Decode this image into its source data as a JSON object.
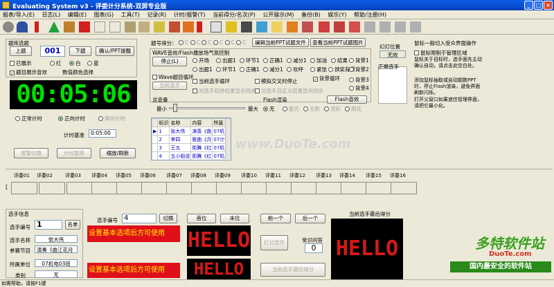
{
  "window": {
    "title": "Evaluating System v3 - 评委计分系统-双屏专业版"
  },
  "menu": [
    "报表/导入(E)",
    "日志(L)",
    "编辑(E)",
    "图表(G)",
    "工具(T)",
    "记录(R)",
    "计时/报警(T)",
    "当前得分/名次(P)",
    "公开展示(M)",
    "备份(B)",
    "娱乐(Y)",
    "帮助/注册(H)"
  ],
  "question": {
    "header": "题库选题",
    "prev": "上题",
    "num": "001",
    "next": "下题",
    "confirm": "确认/PPT提醒",
    "shown": "已展示",
    "colors": [
      "红",
      "白",
      "蓝"
    ],
    "topic_sound": "题目展示音效",
    "num_color": "数值颜色选择"
  },
  "timer": {
    "display": "00:05:06",
    "modes": [
      "正常计时",
      "正向计时",
      "倒向计时"
    ],
    "base_label": "计时基准",
    "base_value": "0:05:00",
    "btn_alarm": "报警切换",
    "btn_pause": "计时暂停",
    "btn_zoom": "缩放/刷新"
  },
  "mid": {
    "diff_label": "题号得分：",
    "diffs": [
      "C",
      "C",
      "C",
      "C",
      "C",
      "C"
    ],
    "load_ppt": "编辑当前PPT试题文件",
    "view_ppt": "查看当前PPT试题图片",
    "wave_group": "WAVE音效/Flash播放场气氛控制",
    "stop": "停止(L)",
    "wave_loop": "Wave题目循环",
    "cur_player": "当前选手",
    "wave_opts": [
      "开场",
      "出题1",
      "环节1",
      "正确1",
      "减分1",
      "加油",
      "结果",
      "背景1",
      "出题1",
      "环节1",
      "正确1",
      "减分1",
      "欢呼",
      "紧张",
      "颁奖背景",
      "背景2",
      "背景3",
      "背景4"
    ],
    "loop": "背景循环",
    "cur_loop": "当前选手循环",
    "auto_stop": "模拟交叉时停止",
    "cur_all": "对选手较终结果显示同步",
    "sync_all": "对选手自定义结果显示同步",
    "total_label": "总音量",
    "min": "最小",
    "max": "最大",
    "flash_label": "Flash渲染",
    "flash_btn": "Flash音效",
    "flash_opts": [
      "无",
      "星光",
      "光影",
      "流彩",
      "雨花"
    ]
  },
  "fantasy": {
    "label": "幻灯位置",
    "value": "无效",
    "pos_label": "正展选手",
    "items": [
      "前展1",
      "前展2",
      "前展3",
      "前展4",
      "前展5"
    ]
  },
  "hint": {
    "mouse": "鼠标一般切入受众界面操作",
    "chk": "鼠标限制于管理区域",
    "p1": "鼠标关于目标时，选手面先主动确认自动，请点击此空白处。",
    "p2": "添加鼠标抽取或自动题数PPT时，停止Flash渲染，避免界面刷新闪烁。",
    "p3": "打开父窗口如果遮住管理界面，请把它最小化。"
  },
  "players_table": {
    "headers": [
      "",
      "标识",
      "名称",
      "内容",
      "所属"
    ],
    "rows": [
      [
        "",
        "1",
        "张大伟",
        "演奏《曲",
        "07机电03"
      ],
      [
        "",
        "2",
        "李四",
        "歌曲《月",
        "07计信07"
      ],
      [
        "",
        "3",
        "王五",
        "街舞《红",
        "07机电03"
      ],
      [
        "",
        "4",
        "五小姐说",
        "街舞《红",
        "07机电03"
      ]
    ]
  },
  "judges": [
    "评委01",
    "评委02",
    "评委03",
    "评委04",
    "评委05",
    "评委06",
    "评委07",
    "评委08",
    "评委09",
    "评委10",
    "评委11",
    "评委12",
    "评委13",
    "评委14",
    "评委15",
    "评委16"
  ],
  "player_info": {
    "header": "选手信息",
    "id_label": "选手编号",
    "id_value": "1",
    "name_btn": "名单",
    "name_label": "选手名称",
    "name_value": "张大伟",
    "prog_label": "参赛节目",
    "prog_value": "演奏《曲江花月",
    "unit_label": "所属单位",
    "unit_value": "07机电03班",
    "cat_label": "类别",
    "cat_value": "无"
  },
  "selector": {
    "id_label": "选手编号",
    "id_value": "4",
    "switch": "切换",
    "first": "首位",
    "last": "末位",
    "prev": "前一个",
    "next": "后一个",
    "scroll1": "设置基本选项后方可使用",
    "scroll2": "设置基本选项后方可使用",
    "hello": "HELLO"
  },
  "score": {
    "title": "当前选手最后得分",
    "display_btn": "打分显示",
    "audience_label": "常识问答",
    "audience_value": "0",
    "final_btn": "当前选手最后得分",
    "hello": "HELLO"
  },
  "status": "如需帮助，请按F1键",
  "watermarks": [
    "www.DuoTe.com",
    "多特软件站",
    "DuoTe.com",
    "国内最安全的软件站"
  ],
  "colors": {
    "led": "#d81818",
    "scroll_bg": "#e0101a",
    "scroll_fg": "#ffef00",
    "timer": "#00e000"
  }
}
